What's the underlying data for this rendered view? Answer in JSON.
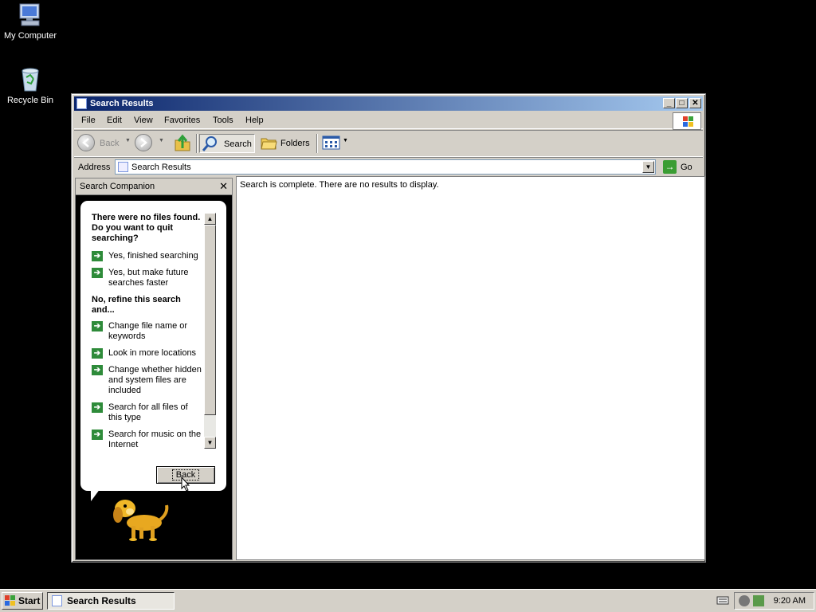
{
  "desktop": {
    "icons": [
      {
        "label": "My Computer"
      },
      {
        "label": "Recycle Bin"
      }
    ]
  },
  "window": {
    "title": "Search Results",
    "controls": {
      "minimize": "_",
      "maximize": "□",
      "close": "✕"
    },
    "menu": [
      "File",
      "Edit",
      "View",
      "Favorites",
      "Tools",
      "Help"
    ],
    "toolbar": {
      "back": "Back",
      "search": "Search",
      "folders": "Folders"
    },
    "address": {
      "label": "Address",
      "value": "Search Results",
      "go": "Go"
    },
    "companion": {
      "title": "Search Companion",
      "question": "There were no files found.  Do you want to quit searching?",
      "options_quit": [
        "Yes, finished searching",
        "Yes, but make future searches faster"
      ],
      "refine_heading": "No, refine this search and...",
      "options_refine": [
        "Change file name or keywords",
        "Look in more locations",
        "Change whether hidden and system files are included",
        "Search for all files of this type",
        "Search for music on the Internet"
      ],
      "back_button": "Back"
    },
    "results": {
      "message": "Search is complete. There are no results to display."
    }
  },
  "taskbar": {
    "start": "Start",
    "task": "Search Results",
    "clock": "9:20 AM"
  },
  "colors": {
    "title_gradient_start": "#0a246a",
    "title_gradient_end": "#a6caf0",
    "face": "#d4d0c8",
    "arrow_green": "#2e8b3a"
  }
}
